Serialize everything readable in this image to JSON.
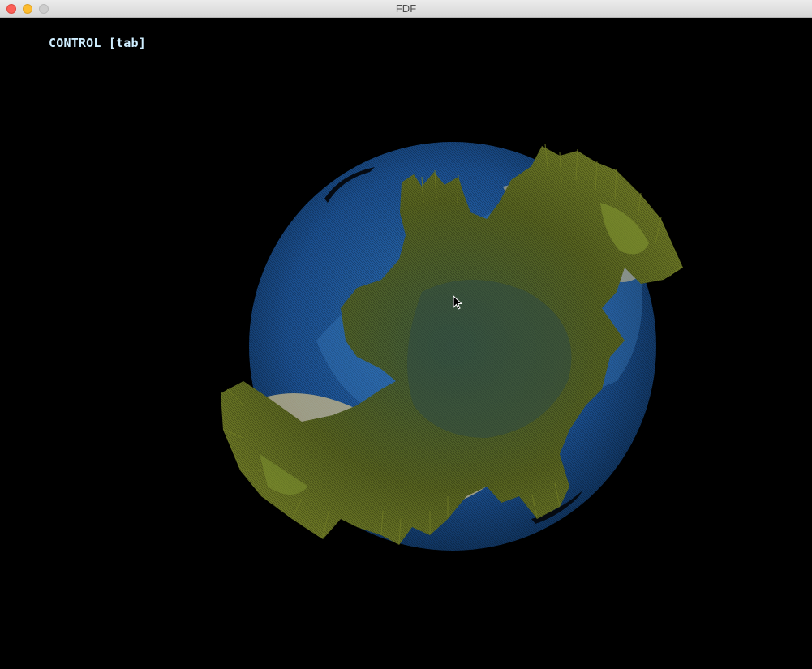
{
  "window": {
    "title": "FDF"
  },
  "overlay": {
    "control_hint": "CONTROL [tab]"
  },
  "colors": {
    "background": "#000000",
    "ocean": "#1b4f8f",
    "land_dark": "#4f5a1e",
    "land_mid": "#6b7a2c",
    "sand": "#c9b98a",
    "hint_text": "#cfeeff"
  },
  "icons": {
    "close": "close-icon",
    "minimize": "minimize-icon",
    "maximize": "maximize-icon",
    "cursor": "mouse-pointer-icon"
  }
}
